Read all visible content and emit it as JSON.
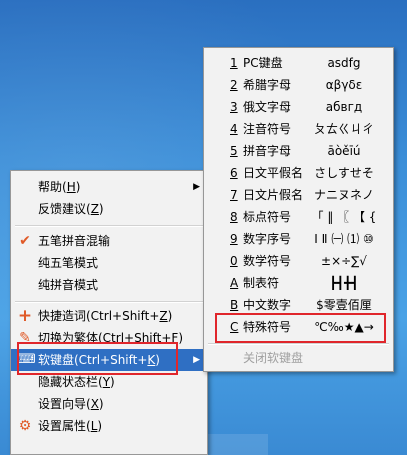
{
  "main_menu": {
    "items": [
      {
        "label": "帮助(",
        "key": "H",
        "suffix": ")",
        "submenu": true
      },
      {
        "label": "反馈建议(",
        "key": "Z",
        "suffix": ")"
      },
      {
        "label": "五笔拼音混输",
        "checked": true
      },
      {
        "label": "纯五笔模式"
      },
      {
        "label": "纯拼音模式"
      },
      {
        "label": "快捷造词(Ctrl+Shift+",
        "key": "Z",
        "suffix": ")",
        "icon": "plus-icon"
      },
      {
        "label": "切换为繁体(Ctrl+Shift+F)",
        "icon": "pencil-icon"
      },
      {
        "label": "软键盘(Ctrl+Shift+",
        "key": "K",
        "suffix": ")",
        "icon": "keyboard-icon",
        "submenu": true,
        "highlighted": true
      },
      {
        "label": "隐藏状态栏(",
        "key": "Y",
        "suffix": ")"
      },
      {
        "label": "设置向导(",
        "key": "X",
        "suffix": ")"
      },
      {
        "label": "设置属性(",
        "key": "L",
        "suffix": ")",
        "icon": "gear-icon"
      }
    ]
  },
  "soft_keyboard_menu": {
    "items": [
      {
        "num": "1",
        "name": "PC键盘",
        "sample": "asdfg"
      },
      {
        "num": "2",
        "name": "希腊字母",
        "sample": "αβγδε"
      },
      {
        "num": "3",
        "name": "俄文字母",
        "sample": "абвгд"
      },
      {
        "num": "4",
        "name": "注音符号",
        "sample": "ㄆㄊㄍㄐㄔ"
      },
      {
        "num": "5",
        "name": "拼音字母",
        "sample": "āòěīú"
      },
      {
        "num": "6",
        "name": "日文平假名",
        "sample": "さしすせそ"
      },
      {
        "num": "7",
        "name": "日文片假名",
        "sample": "ナニヌネノ"
      },
      {
        "num": "8",
        "name": "标点符号",
        "sample": "「 ‖ 〖 【 {"
      },
      {
        "num": "9",
        "name": "数字序号",
        "sample": "Ⅰ Ⅱ ㈠ ⑴ ⑩"
      },
      {
        "num": "0",
        "name": "数学符号",
        "sample": "±×÷∑√"
      },
      {
        "num": "A",
        "name": "制表符",
        "sample": "┣┫╋┫"
      },
      {
        "num": "B",
        "name": "中文数字",
        "sample": "$零壹佰厘"
      },
      {
        "num": "C",
        "name": "特殊符号",
        "sample": "℃‰★▲→"
      },
      {
        "num": "",
        "name": "关闭软键盘",
        "sample": "",
        "disabled": true
      }
    ]
  },
  "colors": {
    "highlight": "#2f6fc3",
    "annotation_box": "#e0262b",
    "check": "#e05a28"
  }
}
